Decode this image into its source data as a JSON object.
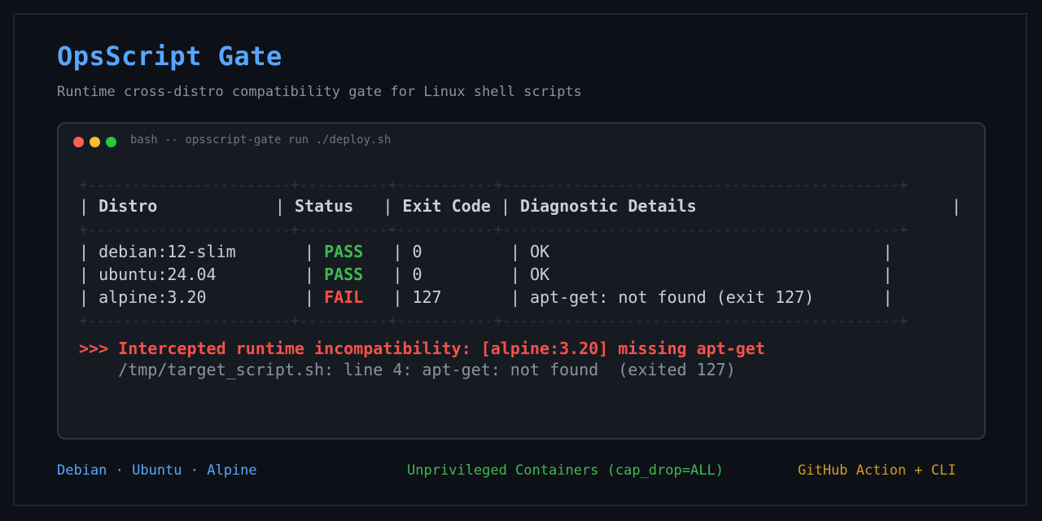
{
  "header": {
    "title": "OpsScript Gate",
    "subtitle": "Runtime cross-distro compatibility gate for Linux shell scripts"
  },
  "terminal": {
    "window_title": "bash -- opsscript-gate run ./deploy.sh",
    "separator": "+-----------------------+----------+-----------+---------------------------------------------+",
    "columns": [
      "Distro",
      "Status",
      "Exit Code",
      "Diagnostic Details"
    ],
    "rows": [
      {
        "distro": "debian:12-slim",
        "status": "PASS",
        "exit_code": "0",
        "details": "OK"
      },
      {
        "distro": "ubuntu:24.04",
        "status": "PASS",
        "exit_code": "0",
        "details": "OK"
      },
      {
        "distro": "alpine:3.20",
        "status": "FAIL",
        "exit_code": "127",
        "details": "apt-get: not found (exit 127)"
      }
    ],
    "alert": ">>> Intercepted runtime incompatibility: [alpine:3.20] missing apt-get",
    "alert_detail": "    /tmp/target_script.sh: line 4: apt-get: not found  (exited 127)"
  },
  "footer": {
    "distros": "Debian · Ubuntu · Alpine",
    "isolation": "Unprivileged Containers (cap_drop=ALL)",
    "integration": "GitHub Action + CLI"
  },
  "colors": {
    "background": "#0d1117",
    "accent_blue": "#58a6ff",
    "pass_green": "#3fb950",
    "fail_red": "#f85149",
    "amber": "#d29922"
  }
}
